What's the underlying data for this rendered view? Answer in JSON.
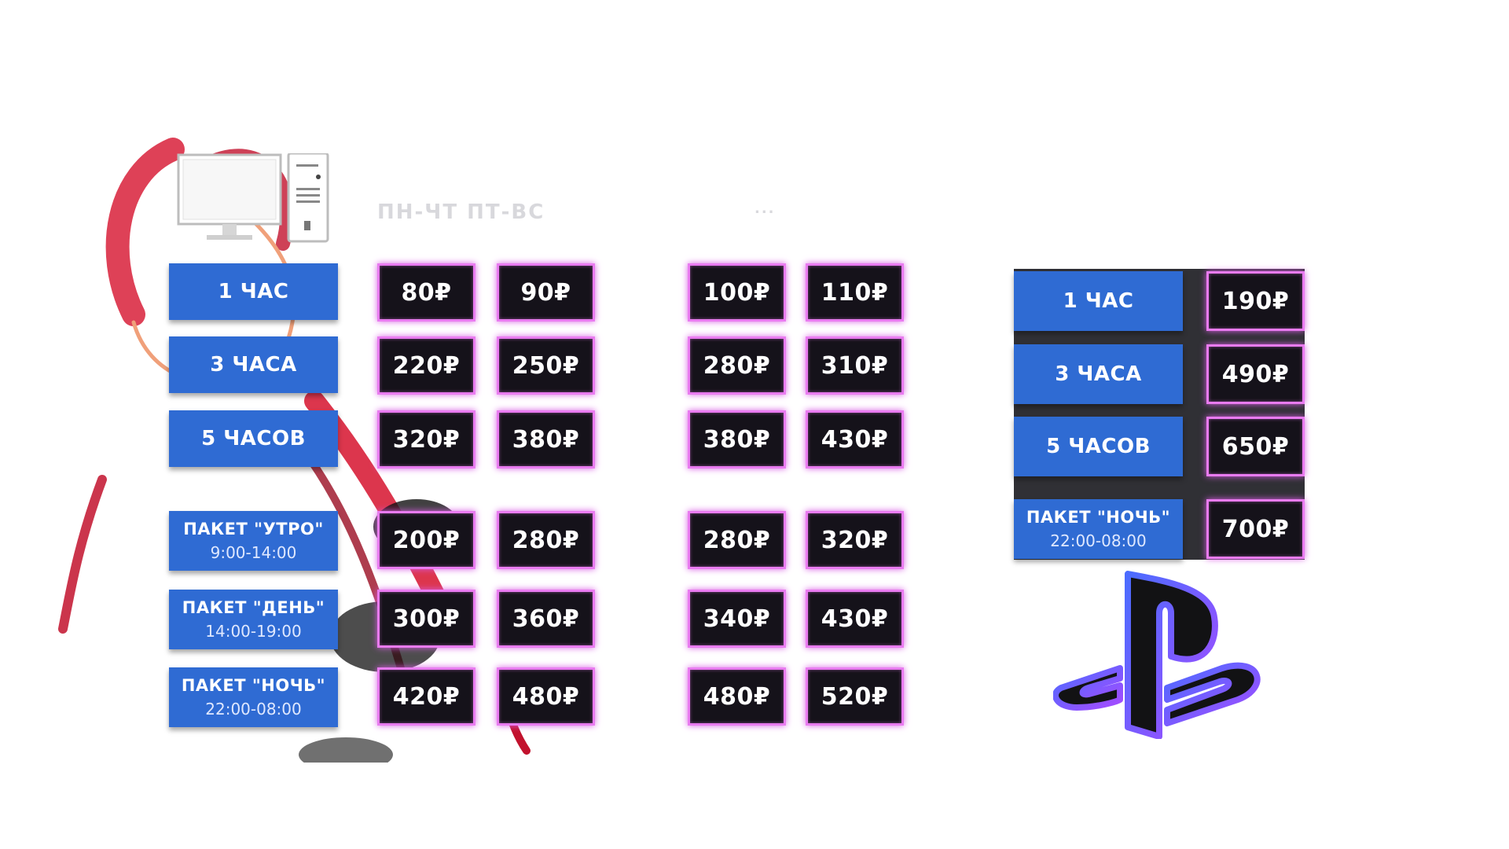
{
  "header": {
    "text": "ПН-ЧТ    ПТ-ВС",
    "right_text": "..."
  },
  "pc": {
    "rows": [
      {
        "label": "1 ЧАС"
      },
      {
        "label": "3 ЧАСА"
      },
      {
        "label": "5 ЧАСОВ"
      },
      {
        "label": "ПАКЕТ \"УТРО\"",
        "time": "9:00-14:00"
      },
      {
        "label": "ПАКЕТ \"ДЕНЬ\"",
        "time": "14:00-19:00"
      },
      {
        "label": "ПАКЕТ \"НОЧЬ\"",
        "time": "22:00-08:00"
      }
    ],
    "prices_a": [
      [
        "80₽",
        "90₽"
      ],
      [
        "220₽",
        "250₽"
      ],
      [
        "320₽",
        "380₽"
      ],
      [
        "200₽",
        "280₽"
      ],
      [
        "300₽",
        "360₽"
      ],
      [
        "420₽",
        "480₽"
      ]
    ],
    "prices_b": [
      [
        "100₽",
        "110₽"
      ],
      [
        "280₽",
        "310₽"
      ],
      [
        "380₽",
        "430₽"
      ],
      [
        "280₽",
        "320₽"
      ],
      [
        "340₽",
        "430₽"
      ],
      [
        "480₽",
        "520₽"
      ]
    ]
  },
  "ps": {
    "rows": [
      {
        "label": "1 ЧАС",
        "price": "190₽"
      },
      {
        "label": "3 ЧАСА",
        "price": "490₽"
      },
      {
        "label": "5 ЧАСОВ",
        "price": "650₽"
      },
      {
        "label": "ПАКЕТ \"НОЧЬ\"",
        "time": "22:00-08:00",
        "price": "700₽"
      }
    ]
  },
  "icons": [
    "pc-icon",
    "playstation-logo-icon"
  ],
  "colors": {
    "label_blue": "#2f6bd3",
    "price_bg": "#15121a",
    "neon_border": "#e97bf0",
    "accent_red": "#d8203a"
  }
}
